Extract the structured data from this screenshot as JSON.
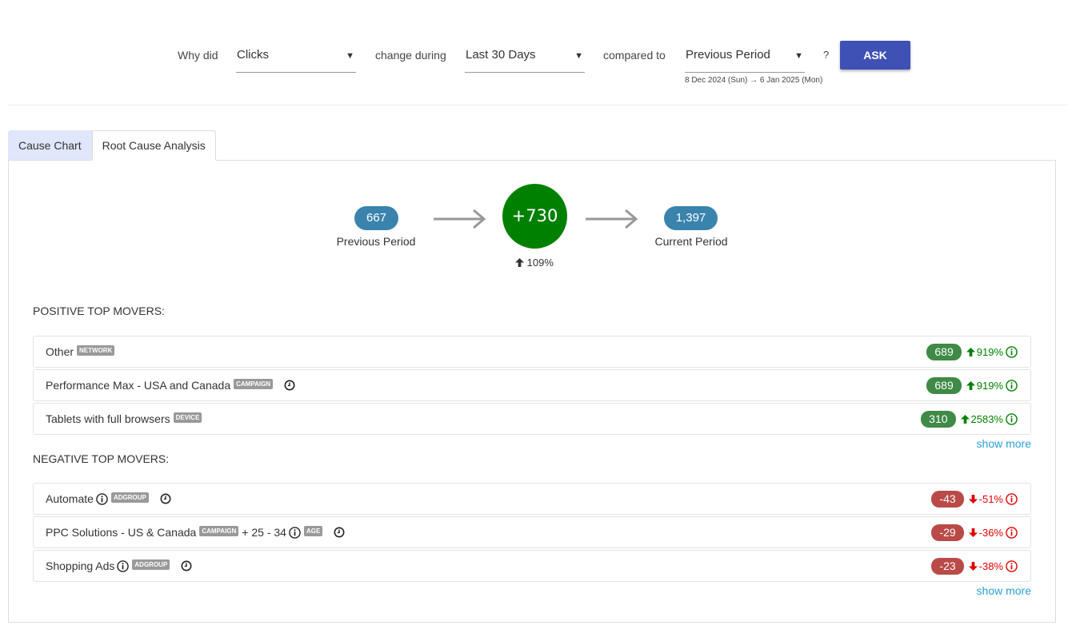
{
  "query": {
    "why_did": "Why did",
    "metric": "Clicks",
    "change_during": "change during",
    "period": "Last 30 Days",
    "compared_to": "compared to",
    "comparison": "Previous Period",
    "date_range": "8 Dec 2024 (Sun) → 6 Jan 2025 (Mon)",
    "help": "?",
    "ask_label": "ASK"
  },
  "tabs": [
    {
      "label": "Cause Chart",
      "active": false
    },
    {
      "label": "Root Cause Analysis",
      "active": true
    }
  ],
  "summary": {
    "previous_value": "667",
    "previous_label": "Previous Period",
    "delta": "+730",
    "delta_pct": "109%",
    "current_value": "1,397",
    "current_label": "Current Period",
    "delta_color": "#008000",
    "pill_color": "#3a83ad"
  },
  "positive": {
    "title": "POSITIVE TOP MOVERS:",
    "show_more": "show more",
    "items": [
      {
        "name": "Other",
        "tag": "NETWORK",
        "value": "689",
        "pct": "919%"
      },
      {
        "name": "Performance Max - USA and Canada",
        "tag": "CAMPAIGN",
        "value": "689",
        "pct": "919%"
      },
      {
        "name": "Tablets with full browsers",
        "tag": "DEVICE",
        "value": "310",
        "pct": "2583%"
      }
    ]
  },
  "negative": {
    "title": "NEGATIVE TOP MOVERS:",
    "show_more": "show more",
    "items": [
      {
        "name": "Automate",
        "tag": "ADGROUP",
        "value": "-43",
        "pct": "-51%"
      },
      {
        "name": "PPC Solutions - US & Canada",
        "tag": "CAMPAIGN",
        "extra": "+ 25 - 34",
        "extra_tag": "AGE",
        "value": "-29",
        "pct": "-36%"
      },
      {
        "name": "Shopping Ads",
        "tag": "ADGROUP",
        "value": "-23",
        "pct": "-38%"
      }
    ]
  },
  "colors": {
    "accent": "#3f51b5",
    "positive": "#008000",
    "negative": "#e00000",
    "positive_pill": "#3f8a47",
    "negative_pill": "#b94a48",
    "link": "#2a9fd8"
  }
}
